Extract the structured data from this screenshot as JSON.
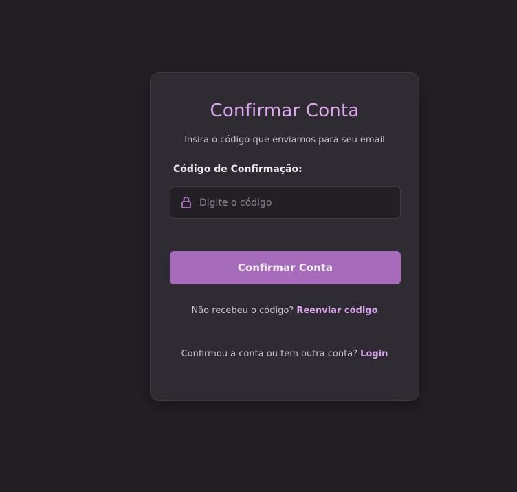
{
  "card": {
    "title": "Confirmar Conta",
    "subtitle": "Insira o código que enviamos para seu email"
  },
  "form": {
    "code_label": "Código de Confirmação:",
    "code_placeholder": "Digite o código",
    "code_value": "",
    "lock_icon": "lock-icon",
    "submit_label": "Confirmar Conta"
  },
  "resend": {
    "prompt": "Não recebeu o código?",
    "link_label": "Reenviar código"
  },
  "login": {
    "prompt": "Confirmou a conta ou tem outra conta?",
    "link_label": "Login"
  },
  "colors": {
    "background": "#222025",
    "card": "#2e2b32",
    "accent": "#dca7ec",
    "button": "#a76bbb"
  }
}
